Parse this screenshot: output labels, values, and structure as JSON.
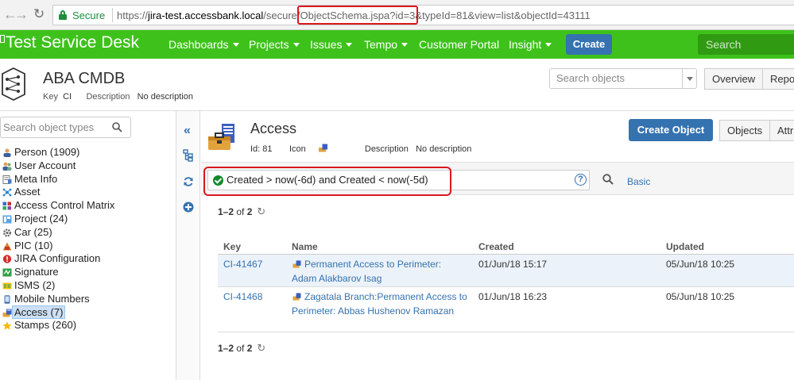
{
  "browser": {
    "secure_label": "Secure",
    "url_prefix": "https://",
    "url_host": "jira-test.accessbank.local",
    "url_path": "/secure/ObjectSchema.jspa?id=3&typeId=81&view=list&objectId=43111"
  },
  "header": {
    "logo_text": "Test Service Desk",
    "nav": [
      {
        "label": "Dashboards"
      },
      {
        "label": "Projects"
      },
      {
        "label": "Issues"
      },
      {
        "label": "Tempo"
      },
      {
        "label": "Customer Portal"
      },
      {
        "label": "Insight"
      }
    ],
    "create_label": "Create",
    "search_placeholder": "Search",
    "brand_color": "#3ec21b"
  },
  "schema": {
    "title": "ABA CMDB",
    "key_label": "Key",
    "key_value": "CI",
    "description_label": "Description",
    "description_value": "No description",
    "search_placeholder": "Search objects",
    "overview_label": "Overview",
    "reports_label": "Repo"
  },
  "sidebar": {
    "search_placeholder": "Search object types",
    "types": [
      {
        "label": "Person (1909)",
        "icon": "person-icon"
      },
      {
        "label": "User Account",
        "icon": "user-account-icon"
      },
      {
        "label": "Meta Info",
        "icon": "meta-info-icon"
      },
      {
        "label": "Asset",
        "icon": "asset-icon"
      },
      {
        "label": "Access Control Matrix",
        "icon": "matrix-icon"
      },
      {
        "label": "Project (24)",
        "icon": "project-icon"
      },
      {
        "label": "Car (25)",
        "icon": "gear-icon"
      },
      {
        "label": "PIC (10)",
        "icon": "pic-icon"
      },
      {
        "label": "JIRA Configuration",
        "icon": "alert-icon"
      },
      {
        "label": "Signature",
        "icon": "signature-icon"
      },
      {
        "label": "ISMS (2)",
        "icon": "isms-icon"
      },
      {
        "label": "Mobile Numbers",
        "icon": "mobile-icon"
      },
      {
        "label": "Access (7)",
        "icon": "access-icon"
      },
      {
        "label": "Stamps (260)",
        "icon": "star-icon"
      }
    ]
  },
  "object_type": {
    "title": "Access",
    "id_label": "Id:",
    "id_value": "81",
    "icon_label": "Icon",
    "description_label": "Description",
    "description_value": "No description",
    "create_object_label": "Create Object",
    "objects_tab_label": "Objects",
    "attributes_tab_label": "Attr"
  },
  "iql": {
    "query": "Created > now(-6d) and Created < now(-5d)",
    "help_label": "?",
    "basic_label": "Basic"
  },
  "pager": {
    "range": "1–2",
    "of_label": "of",
    "total": "2"
  },
  "results": {
    "columns": [
      "Key",
      "Name",
      "Created",
      "Updated"
    ],
    "rows": [
      {
        "key": "CI-41467",
        "name": "Permanent Access to Perimeter: Adam Alakbarov Isag",
        "created": "01/Jun/18 15:17",
        "updated": "05/Jun/18 10:25"
      },
      {
        "key": "CI-41468",
        "name": "Zagatala Branch:Permanent Access to Perimeter: Abbas Hushenov Ramazan",
        "created": "01/Jun/18 16:23",
        "updated": "05/Jun/18 10:25"
      }
    ]
  }
}
